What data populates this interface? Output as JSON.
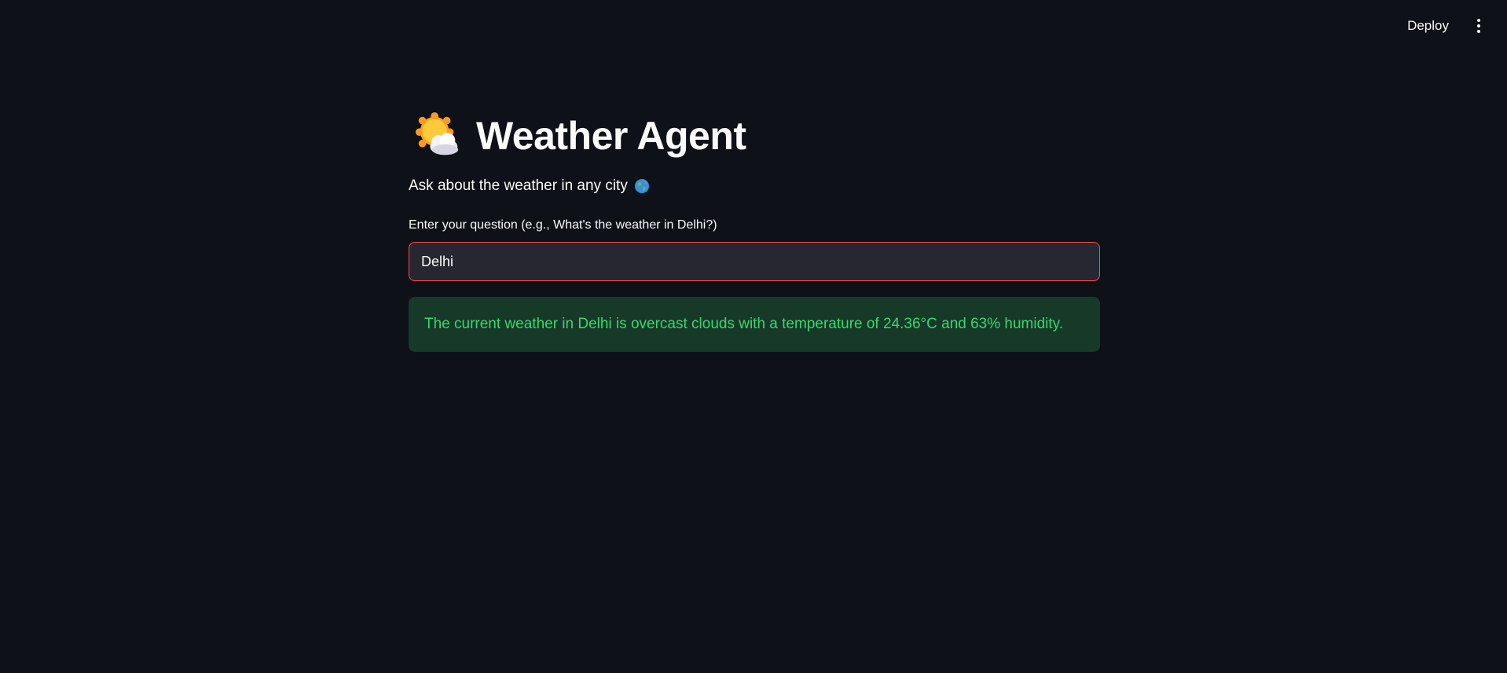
{
  "toolbar": {
    "deploy_label": "Deploy",
    "menu_icon": "vertical-ellipsis-icon"
  },
  "header": {
    "icon": "sun-behind-cloud-icon",
    "title": "Weather Agent"
  },
  "subtitle": {
    "text": "Ask about the weather in any city",
    "icon": "globe-icon"
  },
  "question": {
    "label": "Enter your question (e.g., What's the weather in Delhi?)",
    "value": "Delhi"
  },
  "result": {
    "text": "The current weather in Delhi is overcast clouds with a temperature of 24.36°C and 63% humidity."
  },
  "colors": {
    "background": "#0e1117",
    "input_bg": "#262730",
    "input_border_focus": "#ff4b4b",
    "success_bg": "#173928",
    "success_text": "#3dd56d"
  }
}
